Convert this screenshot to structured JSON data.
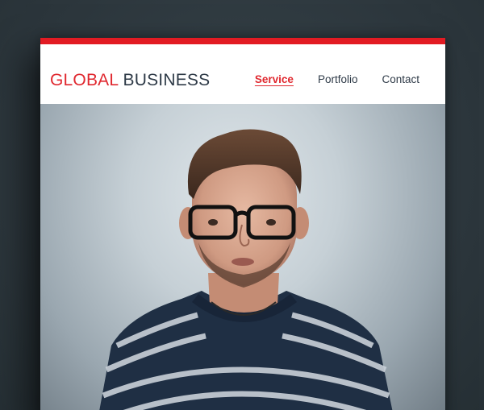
{
  "site": {
    "logo_part1": "GLOBAL",
    "logo_part2": "BUSINESS",
    "accent_color": "#e21b23",
    "text_color": "#2e3a47"
  },
  "nav": {
    "items": [
      {
        "label": "Service",
        "active": true
      },
      {
        "label": "Portfolio",
        "active": false
      },
      {
        "label": "Contact",
        "active": false
      }
    ]
  },
  "hero": {
    "image": "portrait-photo"
  }
}
